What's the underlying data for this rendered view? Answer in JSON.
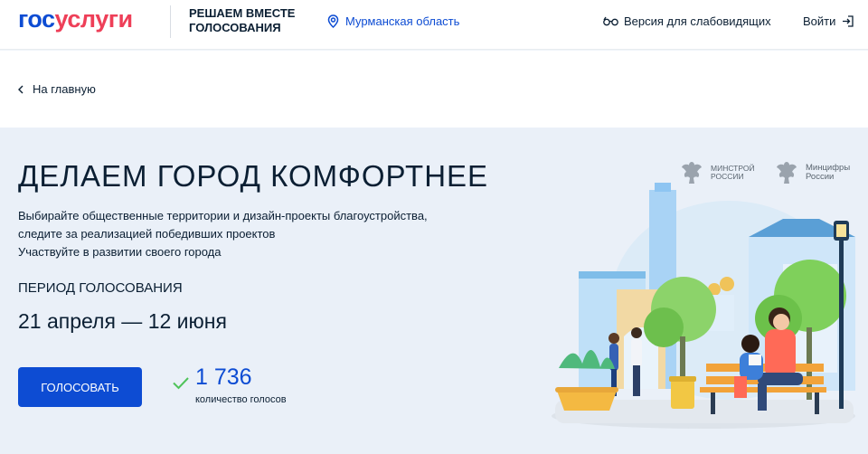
{
  "header": {
    "logo_part1": "гос",
    "logo_part2": "услуги",
    "project_line1": "РЕШАЕМ ВМЕСТЕ",
    "project_line2": "ГОЛОСОВАНИЯ",
    "region": "Мурманская область",
    "accessibility": "Версия для слабовидящих",
    "login": "Войти"
  },
  "breadcrumb": {
    "back": "На главную"
  },
  "hero": {
    "title": "ДЕЛАЕМ ГОРОД КОМФОРТНЕЕ",
    "desc_line1": "Выбирайте общественные территории и дизайн-проекты благоустройства,",
    "desc_line2": "следите за реализацией победивших проектов",
    "desc_line3": "Участвуйте в развитии своего города",
    "period_label": "ПЕРИОД ГОЛОСОВАНИЯ",
    "period_value": "21 апреля — 12 июня",
    "vote_button": "ГОЛОСОВАТЬ",
    "vote_count": "1 736",
    "vote_count_label": "количество голосов"
  },
  "partners": {
    "minstroy_line1": "Минстрой",
    "minstroy_line2": "России",
    "mincifry_line1": "Минцифры",
    "mincifry_line2": "России"
  },
  "colors": {
    "brand_blue": "#0d4cd3",
    "brand_red": "#ee3f58",
    "check_green": "#4fc35a"
  }
}
